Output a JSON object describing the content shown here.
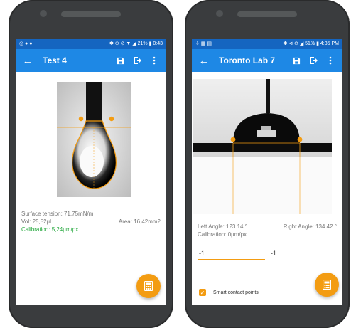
{
  "left_phone": {
    "status": {
      "left": "◎ ● ●",
      "right": "✱ ⊙ ⊘ ▼ ◢ 21% ▮ 0:43"
    },
    "appbar": {
      "title": "Test 4"
    },
    "measurements": {
      "surface_tension": "Surface tension: 71,75mN/m",
      "volume": "Vol: 25,52µl",
      "area": "Area: 16,42mm2",
      "calibration": "Calibration: 5,24µm/px"
    }
  },
  "right_phone": {
    "status": {
      "left": "⇩ ▦ ▤",
      "right": "✱ ⊲ ⊘ ◢ 51% ▮ 4:35 PM"
    },
    "appbar": {
      "title": "Toronto Lab 7"
    },
    "measurements": {
      "left_angle": "Left Angle: 123.14 °",
      "right_angle": "Right Angle: 134.42 °",
      "calibration": "Calibration: 0µm/px"
    },
    "inputs": {
      "left_value": "-1",
      "right_value": "-1"
    },
    "checkbox": {
      "label": "Smart contact points",
      "checked": true
    }
  },
  "colors": {
    "status_bar": "#1565c0",
    "app_bar": "#1e88e5",
    "accent": "#f39c12",
    "calibration_text": "#21a73a"
  },
  "icons": {
    "back": "arrow-left-icon",
    "save": "save-icon",
    "export": "export-icon",
    "more": "more-vert-icon",
    "fab": "calculator-icon"
  }
}
